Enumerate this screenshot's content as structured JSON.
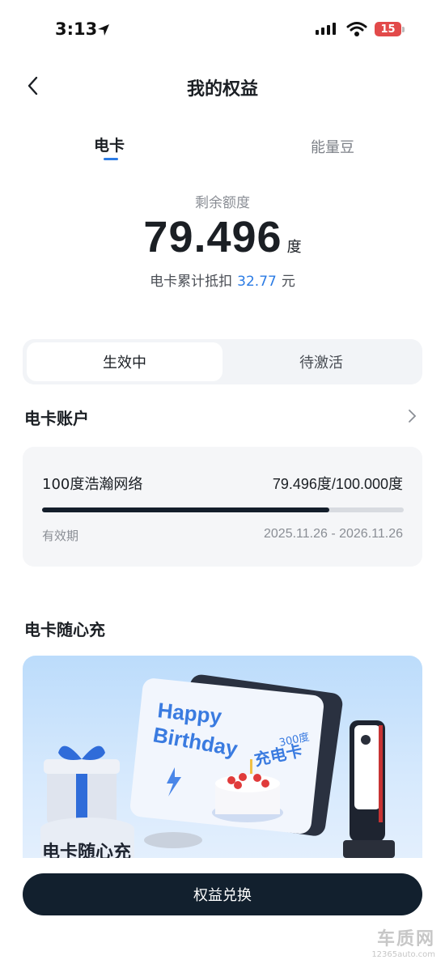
{
  "status_bar": {
    "time": "3:13",
    "battery": "15"
  },
  "nav": {
    "title": "我的权益"
  },
  "tabs": [
    {
      "label": "电卡",
      "active": true
    },
    {
      "label": "能量豆",
      "active": false
    }
  ],
  "summary": {
    "remaining_label": "剩余额度",
    "remaining_value": "79.496",
    "remaining_unit": "度",
    "deduct_prefix": "电卡累计抵扣",
    "deduct_amount": "32.77",
    "deduct_unit": "元"
  },
  "segment": [
    {
      "label": "生效中",
      "active": true
    },
    {
      "label": "待激活",
      "active": false
    }
  ],
  "account": {
    "title": "电卡账户",
    "card": {
      "name": "100度浩瀚网络",
      "usage": "79.496度/100.000度",
      "progress": 0.795,
      "validity_label": "有效期",
      "validity_range": "2025.11.26 - 2026.11.26"
    }
  },
  "promo": {
    "title": "电卡随心充",
    "banner": {
      "line1": "Happy",
      "line2": "Birthday",
      "card_deg": "300度",
      "card_name": "充电卡",
      "footer": "电卡随心充"
    }
  },
  "footer_button": {
    "label": "权益兑换"
  },
  "watermark": {
    "big": "车质网",
    "small": "12365auto.com"
  },
  "colors": {
    "accent": "#2b7be4",
    "dark": "#12202e"
  }
}
